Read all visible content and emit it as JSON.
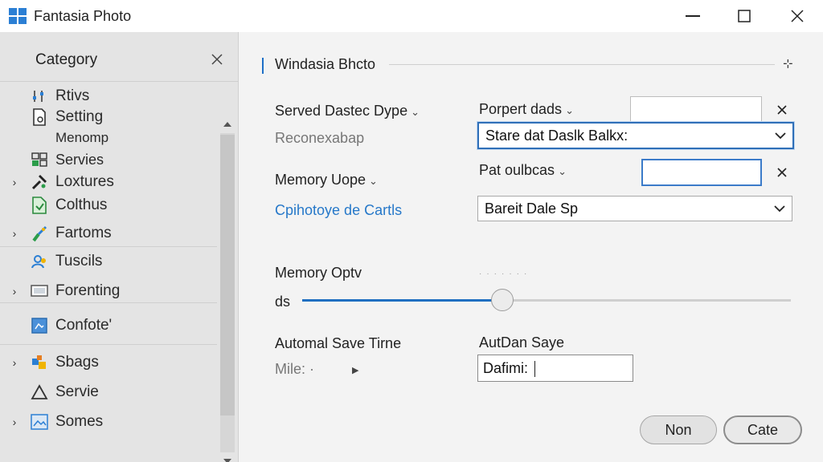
{
  "window": {
    "title": "Fantasia Photo"
  },
  "sidebar": {
    "title": "Category",
    "items": [
      {
        "label": "Rtivs",
        "icon": "sliders-icon",
        "has_arrow": false
      },
      {
        "label": "Setting",
        "icon": "document-icon",
        "has_arrow": false
      },
      {
        "label": "Menomp",
        "icon": "",
        "has_arrow": false
      },
      {
        "label": "Servies",
        "icon": "grid-icon",
        "has_arrow": false
      },
      {
        "label": "Loxtures",
        "icon": "hammer-icon",
        "has_arrow": true
      },
      {
        "label": "Colthus",
        "icon": "green-document-icon",
        "has_arrow": false
      },
      {
        "label": "Fartoms",
        "icon": "brush-icon",
        "has_arrow": true
      },
      {
        "label": "Tuscils",
        "icon": "users-icon",
        "has_arrow": false
      },
      {
        "label": "Forenting",
        "icon": "monitor-icon",
        "has_arrow": true
      },
      {
        "label": "Confote'",
        "icon": "blue-square-icon",
        "has_arrow": false
      },
      {
        "label": "Sbags",
        "icon": "puzzle-icon",
        "has_arrow": true
      },
      {
        "label": "Servie",
        "icon": "triangle-icon",
        "has_arrow": false
      },
      {
        "label": "Somes",
        "icon": "image-icon",
        "has_arrow": true
      }
    ]
  },
  "main": {
    "heading": "Windasia Bhcto",
    "pin_glyph": "⊹",
    "row1": {
      "left_label": "Served  Dastec Dype",
      "left_sub": "Reconexabap",
      "right_label": "Porpert dads",
      "select_value": "Stare dat Daslk Balkx:"
    },
    "row2": {
      "left_label": "Memory Uope",
      "left_sub": "Cpihotoye de Cartls",
      "right_label": "Pat oulbcas",
      "select_value": "Bareit Dale Sp"
    },
    "memory": {
      "label": "Memory Optv",
      "slider_label": "ds",
      "slider_value": 0.41
    },
    "autosave": {
      "left_label": "Automal Save Tirne",
      "left_sub": "Mile: ·",
      "right_label": "AutDan Saye",
      "input_value": "Dafimi:"
    },
    "buttons": {
      "secondary": "Non",
      "primary": "Cate"
    }
  },
  "colors": {
    "accent": "#1f6fc1",
    "link": "#2678c9"
  }
}
